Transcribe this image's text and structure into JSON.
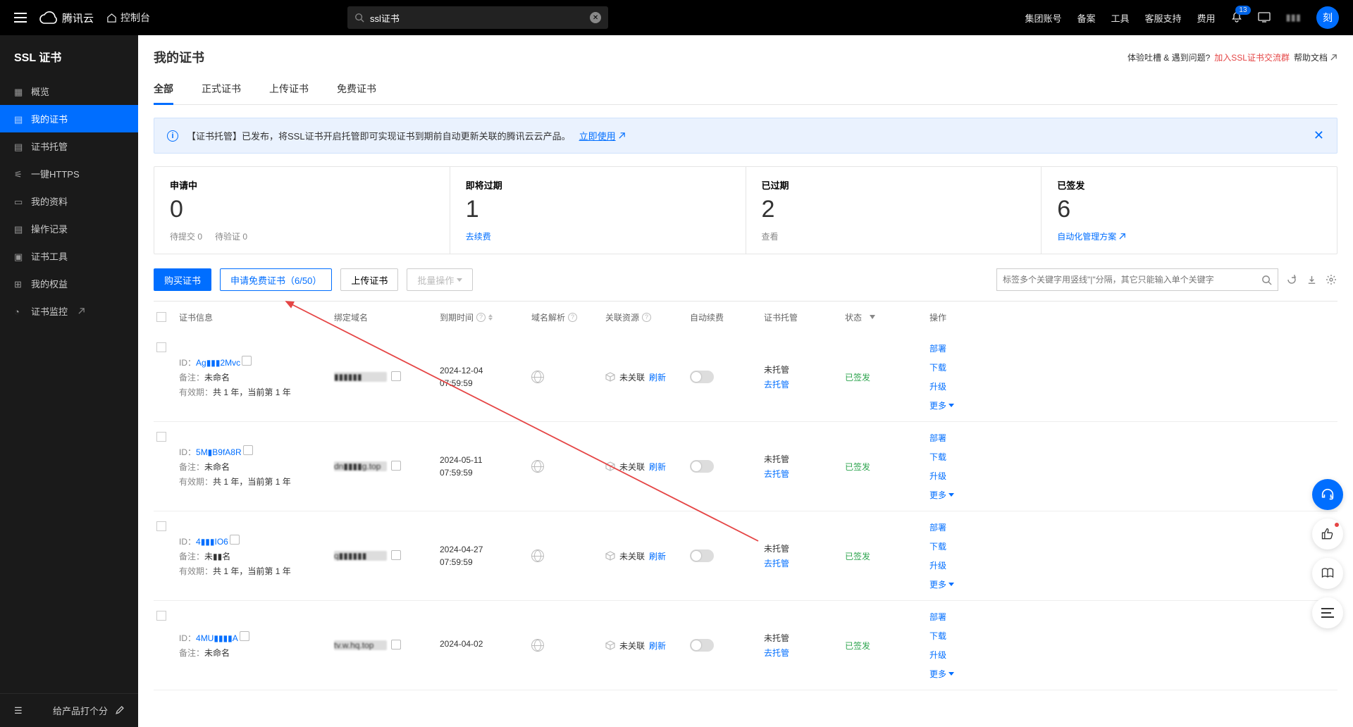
{
  "topbar": {
    "brand": "腾讯云",
    "console": "控制台",
    "search_value": "ssl证书",
    "items": [
      "集团账号",
      "备案",
      "工具",
      "客服支持",
      "费用"
    ],
    "notif_count": "13",
    "avatar": "刻"
  },
  "sidebar": {
    "title": "SSL 证书",
    "items": [
      {
        "label": "概览",
        "icon": "grid"
      },
      {
        "label": "我的证书",
        "icon": "doc",
        "active": true
      },
      {
        "label": "证书托管",
        "icon": "doc"
      },
      {
        "label": "一键HTTPS",
        "icon": "sliders"
      },
      {
        "label": "我的资料",
        "icon": "folder"
      },
      {
        "label": "操作记录",
        "icon": "list"
      },
      {
        "label": "证书工具",
        "icon": "tool"
      },
      {
        "label": "我的权益",
        "icon": "gift"
      },
      {
        "label": "证书监控",
        "icon": "gauge",
        "external": true
      }
    ],
    "footer": "给产品打个分"
  },
  "page": {
    "title": "我的证书",
    "feedback": "体验吐槽 & 遇到问题?",
    "join_group": "加入SSL证书交流群",
    "help_doc": "帮助文档"
  },
  "tabs": [
    "全部",
    "正式证书",
    "上传证书",
    "免费证书"
  ],
  "banner": {
    "text": "【证书托管】已发布，将SSL证书开启托管即可实现证书到期前自动更新关联的腾讯云云产品。",
    "link": "立即使用"
  },
  "stats": [
    {
      "label": "申请中",
      "value": "0",
      "foot1": "待提交 0",
      "foot2": "待验证 0"
    },
    {
      "label": "即将过期",
      "value": "1",
      "link": "去续费"
    },
    {
      "label": "已过期",
      "value": "2",
      "foot1": "查看"
    },
    {
      "label": "已签发",
      "value": "6",
      "link": "自动化管理方案"
    }
  ],
  "toolbar": {
    "buy": "购买证书",
    "apply_free": "申请免费证书（6/50）",
    "upload": "上传证书",
    "batch": "批量操作",
    "search_placeholder": "标签多个关键字用竖线\"|\"分隔，其它只能输入单个关键字"
  },
  "columns": {
    "info": "证书信息",
    "domain": "绑定域名",
    "expire": "到期时间",
    "dns": "域名解析",
    "assoc": "关联资源",
    "auto": "自动续费",
    "hosting": "证书托管",
    "status": "状态",
    "ops": "操作"
  },
  "cell_labels": {
    "id": "ID：",
    "note": "备注：",
    "validity": "有效期：",
    "unlinked": "未关联",
    "refresh": "刷新",
    "not_hosted": "未托管",
    "go_host": "去托管",
    "issued": "已签发"
  },
  "row_ops": {
    "deploy": "部署",
    "download": "下载",
    "upgrade": "升级",
    "more": "更多"
  },
  "rows": [
    {
      "id": "Ag▮▮▮2Mvc",
      "note": "未命名",
      "validity": "共 1 年，当前第 1 年",
      "domain": "▮▮▮▮▮▮",
      "expire1": "2024-12-04",
      "expire2": "07:59:59"
    },
    {
      "id": "5M▮B9fA8R",
      "note": "未命名",
      "validity": "共 1 年，当前第 1 年",
      "domain": "dn▮▮▮▮g.top",
      "expire1": "2024-05-11",
      "expire2": "07:59:59"
    },
    {
      "id": "4▮▮▮IO6",
      "note": "未▮▮名",
      "validity": "共 1 年，当前第 1 年",
      "domain": "q▮▮▮▮▮▮",
      "expire1": "2024-04-27",
      "expire2": "07:59:59"
    },
    {
      "id": "4MU▮▮▮▮A",
      "note": "未命名",
      "validity": "",
      "domain": "tv.w.hq.top",
      "expire1": "2024-04-02",
      "expire2": ""
    }
  ]
}
